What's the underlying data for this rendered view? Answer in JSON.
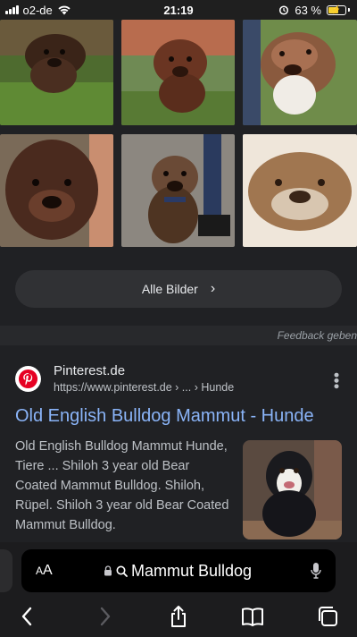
{
  "status_bar": {
    "carrier": "o2-de",
    "time": "21:19",
    "battery_text": "63 %",
    "battery_level": 0.63,
    "icons": [
      "signal-icon",
      "wifi-icon",
      "alarm-icon",
      "battery-charging-icon"
    ]
  },
  "images": {
    "count": 6,
    "subjects": [
      "brown puppy on grass",
      "brown puppy on grass",
      "brindle bulldog",
      "dark brindle bulldog",
      "bulldog on leash",
      "bulldog lying down"
    ]
  },
  "all_images_button": {
    "label": "Alle Bilder",
    "icon": "chevron-right-icon"
  },
  "feedback": {
    "label": "Feedback geben"
  },
  "result": {
    "site_name": "Pinterest.de",
    "url": "https://www.pinterest.de › ... › Hunde",
    "title": "Old English Bulldog Mammut - Hunde",
    "snippet": "Old English Bulldog Mammut Hunde, Tiere ... Shiloh 3 year old Bear Coated Mammut Bulldog. Shiloh, Rüpel. Shiloh 3 year old Bear Coated Mammut Bulldog.",
    "favicon": "pinterest-icon",
    "more_icon": "more-vertical-icon"
  },
  "address_bar": {
    "aa_label": "AA",
    "query": "Mammut Bulldog",
    "icons": [
      "lock-icon",
      "search-icon",
      "microphone-icon"
    ]
  },
  "toolbar": {
    "items": [
      "back-icon",
      "forward-icon",
      "share-icon",
      "bookmarks-icon",
      "tabs-icon"
    ]
  },
  "colors": {
    "background": "#202124",
    "link": "#8ab4f8",
    "button": "#303134",
    "pinterest_red": "#e60023"
  }
}
